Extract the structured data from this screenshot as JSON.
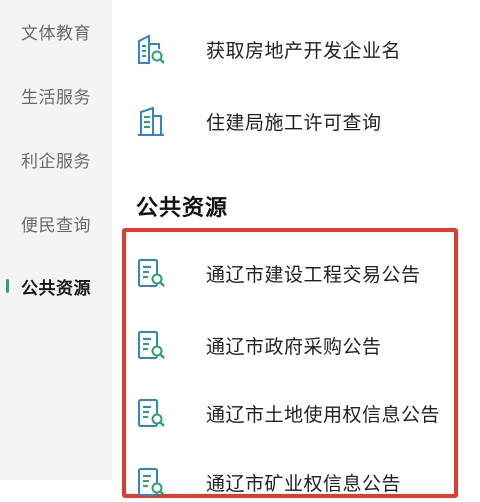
{
  "sidebar": {
    "items": [
      {
        "label": "文体教育"
      },
      {
        "label": "生活服务"
      },
      {
        "label": "利企服务"
      },
      {
        "label": "便民查询"
      },
      {
        "label": "公共资源"
      }
    ],
    "active_index": 4
  },
  "main": {
    "top_links": [
      {
        "label": "获取房地产开发企业名",
        "icon": "building-search-icon"
      },
      {
        "label": "住建局施工许可查询",
        "icon": "building-icon"
      }
    ],
    "section_title": "公共资源",
    "section_links": [
      {
        "label": "通辽市建设工程交易公告",
        "icon": "document-search-icon"
      },
      {
        "label": "通辽市政府采购公告",
        "icon": "document-search-icon"
      },
      {
        "label": "通辽市土地使用权信息公告",
        "icon": "document-search-icon"
      },
      {
        "label": "通辽市矿业权信息公告",
        "icon": "document-search-icon"
      }
    ]
  },
  "colors": {
    "accent": "#2aa56a",
    "icon_blue": "#2f86c8",
    "highlight": "#e23a2e",
    "sidebar_bg": "#f4f4f4"
  }
}
